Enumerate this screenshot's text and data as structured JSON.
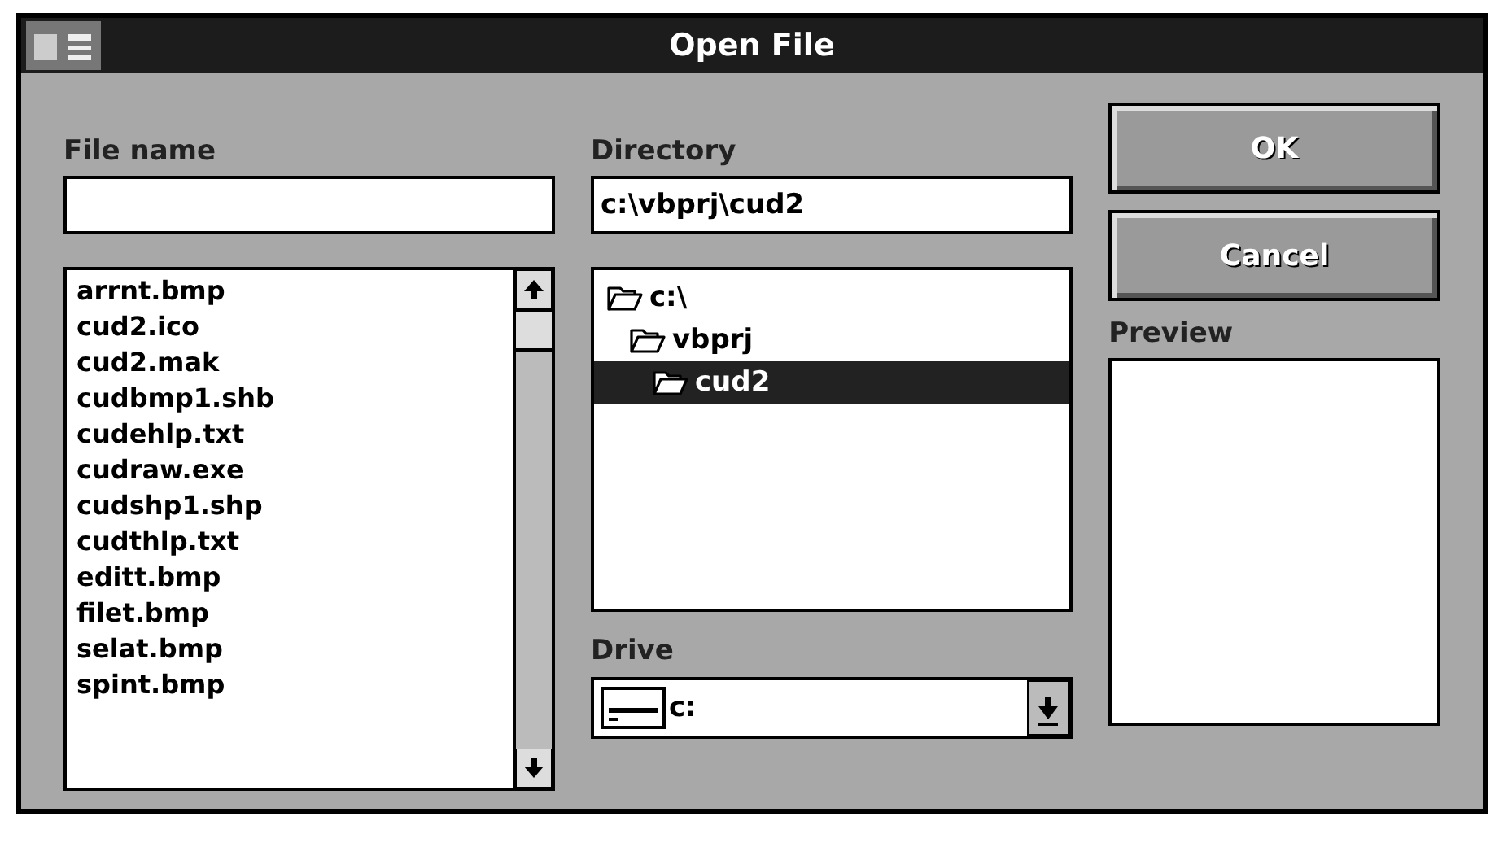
{
  "window": {
    "title": "Open File"
  },
  "file_name": {
    "label": "File name"
  },
  "files": [
    {
      "name": "arrnt.bmp",
      "selected": false
    },
    {
      "name": "cud2.ico",
      "selected": false
    },
    {
      "name": "cud2.mak",
      "selected": false
    },
    {
      "name": "cudbmp1.shb",
      "selected": false
    },
    {
      "name": "cudehlp.txt",
      "selected": false
    },
    {
      "name": "cudraw.exe",
      "selected": false
    },
    {
      "name": "cudshp1.shp",
      "selected": false
    },
    {
      "name": "cudthlp.txt",
      "selected": false
    },
    {
      "name": "editt.bmp",
      "selected": false
    },
    {
      "name": "filet.bmp",
      "selected": false
    },
    {
      "name": "selat.bmp",
      "selected": false
    },
    {
      "name": "spint.bmp",
      "selected": false
    }
  ],
  "directory": {
    "label": "Directory",
    "value": "c:\\vbprj\\cud2",
    "tree": [
      {
        "name": "c:\\",
        "selected": false,
        "children": [
          {
            "name": "vbprj",
            "selected": false,
            "children": [
              {
                "name": "cud2",
                "selected": true
              }
            ]
          }
        ]
      }
    ]
  },
  "drive": {
    "label": "Drive",
    "value": "c:"
  },
  "buttons": [
    {
      "label": "OK"
    },
    {
      "label": "Cancel"
    }
  ],
  "preview": {
    "label": "Preview"
  }
}
